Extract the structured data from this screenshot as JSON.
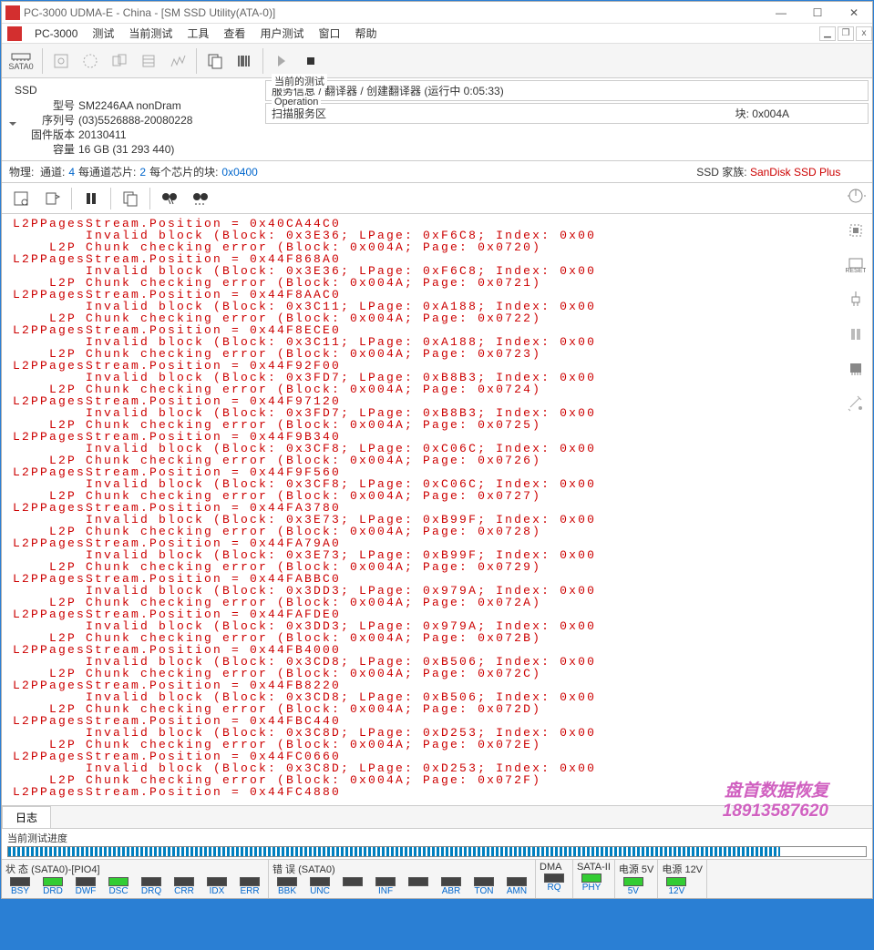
{
  "titlebar": {
    "title": "PC-3000 UDMA-E - China - [SM SSD Utility(ATA-0)]"
  },
  "menubar": {
    "appname": "PC-3000",
    "items": [
      "测试",
      "当前测试",
      "工具",
      "查看",
      "用户测试",
      "窗口",
      "帮助"
    ]
  },
  "toolbar": {
    "sata_label": "SATA0"
  },
  "ssd": {
    "section_label": "SSD",
    "model_label": "型号",
    "model": "SM2246AA nonDram",
    "serial_label": "序列号",
    "serial": "(03)5526888-20080228",
    "fw_label": "固件版本",
    "fw": "20130411",
    "cap_label": "容量",
    "cap": "16 GB (31 293 440)"
  },
  "current_test": {
    "title": "当前的测试",
    "content": "服务信息 / 翻译器 / 创建翻译器 (运行中 0:05:33)"
  },
  "operation": {
    "title": "Operation",
    "content": "扫描服务区",
    "block_label": "块:",
    "block_val": "0x004A"
  },
  "phys": {
    "label": "物理:",
    "channels_label": "通道:",
    "channels": "4",
    "chips_label": "每通道芯片:",
    "chips": "2",
    "blocks_label": "每个芯片的块:",
    "blocks": "0x0400",
    "ssd_family_label": "SSD 家族:",
    "ssd_family": "SanDisk SSD Plus"
  },
  "log_lines": [
    "L2PPagesStream.Position = 0x40CA44C0",
    "        Invalid block (Block: 0x3E36; LPage: 0xF6C8; Index: 0x00",
    "    L2P Chunk checking error (Block: 0x004A; Page: 0x0720)",
    "L2PPagesStream.Position = 0x44F868A0",
    "        Invalid block (Block: 0x3E36; LPage: 0xF6C8; Index: 0x00",
    "    L2P Chunk checking error (Block: 0x004A; Page: 0x0721)",
    "L2PPagesStream.Position = 0x44F8AAC0",
    "        Invalid block (Block: 0x3C11; LPage: 0xA188; Index: 0x00",
    "    L2P Chunk checking error (Block: 0x004A; Page: 0x0722)",
    "L2PPagesStream.Position = 0x44F8ECE0",
    "        Invalid block (Block: 0x3C11; LPage: 0xA188; Index: 0x00",
    "    L2P Chunk checking error (Block: 0x004A; Page: 0x0723)",
    "L2PPagesStream.Position = 0x44F92F00",
    "        Invalid block (Block: 0x3FD7; LPage: 0xB8B3; Index: 0x00",
    "    L2P Chunk checking error (Block: 0x004A; Page: 0x0724)",
    "L2PPagesStream.Position = 0x44F97120",
    "        Invalid block (Block: 0x3FD7; LPage: 0xB8B3; Index: 0x00",
    "    L2P Chunk checking error (Block: 0x004A; Page: 0x0725)",
    "L2PPagesStream.Position = 0x44F9B340",
    "        Invalid block (Block: 0x3CF8; LPage: 0xC06C; Index: 0x00",
    "    L2P Chunk checking error (Block: 0x004A; Page: 0x0726)",
    "L2PPagesStream.Position = 0x44F9F560",
    "        Invalid block (Block: 0x3CF8; LPage: 0xC06C; Index: 0x00",
    "    L2P Chunk checking error (Block: 0x004A; Page: 0x0727)",
    "L2PPagesStream.Position = 0x44FA3780",
    "        Invalid block (Block: 0x3E73; LPage: 0xB99F; Index: 0x00",
    "    L2P Chunk checking error (Block: 0x004A; Page: 0x0728)",
    "L2PPagesStream.Position = 0x44FA79A0",
    "        Invalid block (Block: 0x3E73; LPage: 0xB99F; Index: 0x00",
    "    L2P Chunk checking error (Block: 0x004A; Page: 0x0729)",
    "L2PPagesStream.Position = 0x44FABBC0",
    "        Invalid block (Block: 0x3DD3; LPage: 0x979A; Index: 0x00",
    "    L2P Chunk checking error (Block: 0x004A; Page: 0x072A)",
    "L2PPagesStream.Position = 0x44FAFDE0",
    "        Invalid block (Block: 0x3DD3; LPage: 0x979A; Index: 0x00",
    "    L2P Chunk checking error (Block: 0x004A; Page: 0x072B)",
    "L2PPagesStream.Position = 0x44FB4000",
    "        Invalid block (Block: 0x3CD8; LPage: 0xB506; Index: 0x00",
    "    L2P Chunk checking error (Block: 0x004A; Page: 0x072C)",
    "L2PPagesStream.Position = 0x44FB8220",
    "        Invalid block (Block: 0x3CD8; LPage: 0xB506; Index: 0x00",
    "    L2P Chunk checking error (Block: 0x004A; Page: 0x072D)",
    "L2PPagesStream.Position = 0x44FBC440",
    "        Invalid block (Block: 0x3C8D; LPage: 0xD253; Index: 0x00",
    "    L2P Chunk checking error (Block: 0x004A; Page: 0x072E)",
    "L2PPagesStream.Position = 0x44FC0660",
    "        Invalid block (Block: 0x3C8D; LPage: 0xD253; Index: 0x00",
    "    L2P Chunk checking error (Block: 0x004A; Page: 0x072F)",
    "L2PPagesStream.Position = 0x44FC4880"
  ],
  "tab": {
    "log": "日志"
  },
  "progress": {
    "label": "当前测试进度",
    "percent": 90
  },
  "status": {
    "group1_title": "状 态 (SATA0)-[PIO4]",
    "group1_leds": [
      {
        "lbl": "BSY",
        "on": false
      },
      {
        "lbl": "DRD",
        "on": true
      },
      {
        "lbl": "DWF",
        "on": false
      },
      {
        "lbl": "DSC",
        "on": true
      },
      {
        "lbl": "DRQ",
        "on": false
      },
      {
        "lbl": "CRR",
        "on": false
      },
      {
        "lbl": "IDX",
        "on": false
      },
      {
        "lbl": "ERR",
        "on": false
      }
    ],
    "group2_title": "错 误 (SATA0)",
    "group2_leds": [
      {
        "lbl": "BBK",
        "on": false
      },
      {
        "lbl": "UNC",
        "on": false
      },
      {
        "lbl": "",
        "on": false
      },
      {
        "lbl": "INF",
        "on": false
      },
      {
        "lbl": "",
        "on": false
      },
      {
        "lbl": "ABR",
        "on": false
      },
      {
        "lbl": "TON",
        "on": false
      },
      {
        "lbl": "AMN",
        "on": false
      }
    ],
    "group3_title": "DMA",
    "group3_leds": [
      {
        "lbl": "RQ",
        "on": false
      }
    ],
    "group4_title": "SATA-II",
    "group4_leds": [
      {
        "lbl": "PHY",
        "on": true
      }
    ],
    "group5_title": "电源 5V",
    "group5_leds": [
      {
        "lbl": "5V",
        "on": true
      }
    ],
    "group6_title": "电源 12V",
    "group6_leds": [
      {
        "lbl": "12V",
        "on": true
      }
    ]
  },
  "watermark": {
    "line1": "盘首数据恢复",
    "line2": "18913587620"
  }
}
